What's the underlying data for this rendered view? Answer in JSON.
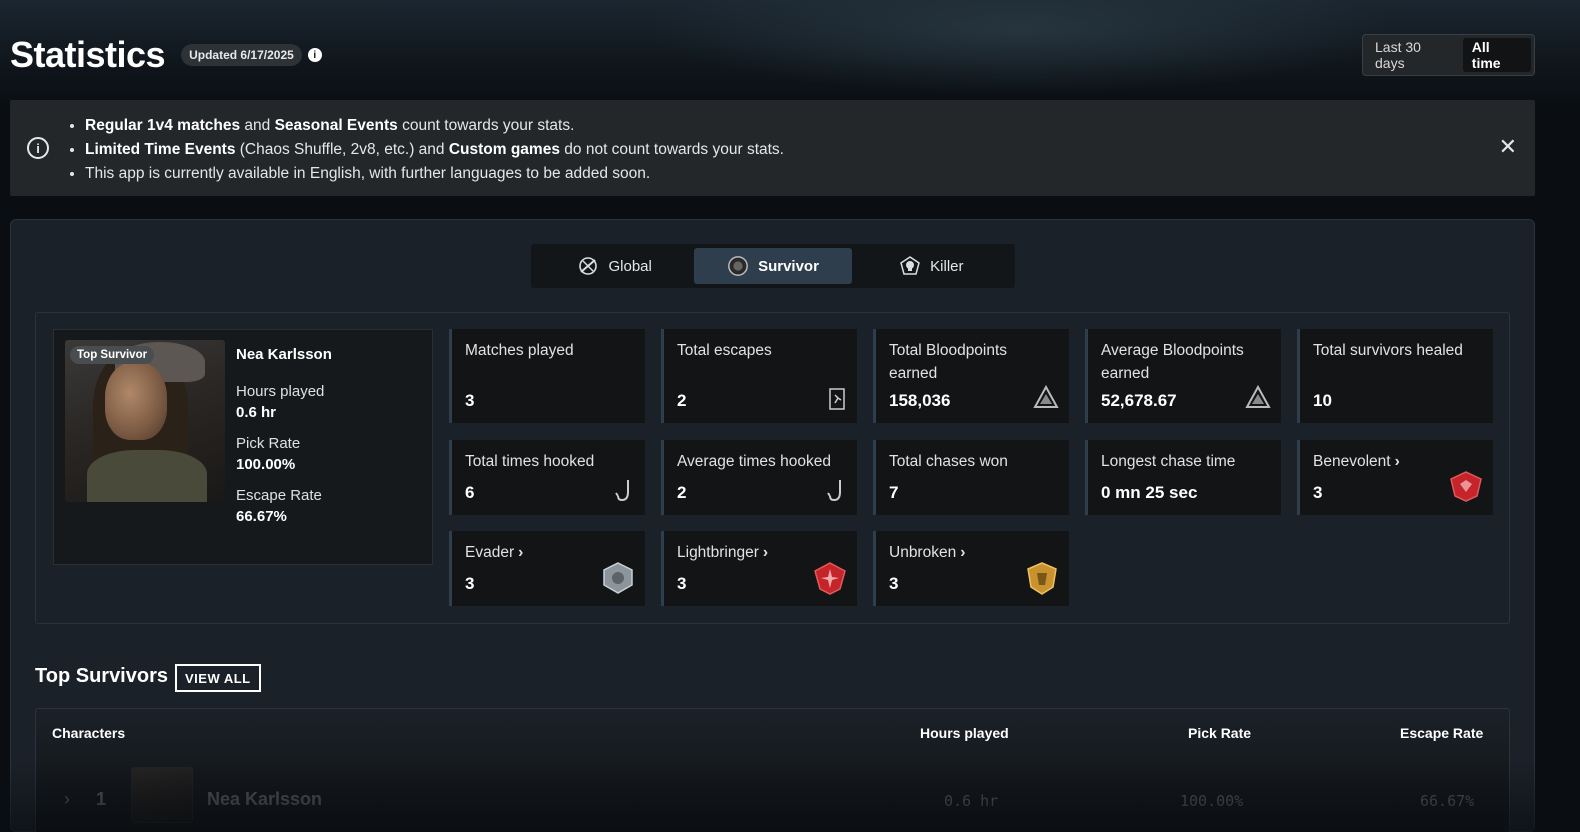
{
  "header": {
    "title": "Statistics",
    "updated": "Updated 6/17/2025",
    "info_glyph": "i"
  },
  "range_toggle": {
    "options": [
      "Last 30 days",
      "All time"
    ],
    "selected": "All time"
  },
  "notice": {
    "icon": "info-circle-icon",
    "line1": {
      "b1": "Regular 1v4 matches",
      "t1": " and ",
      "b2": "Seasonal Events",
      "t2": " count towards your stats."
    },
    "line2": {
      "b1": "Limited Time Events",
      "t1": " (Chaos Shuffle, 2v8, etc.) and ",
      "b2": "Custom games",
      "t2": " do not count towards your stats."
    },
    "line3": "This app is currently available in English, with further languages to be added soon.",
    "close": "✕"
  },
  "tabs": [
    {
      "label": "Global",
      "icon": "global-icon"
    },
    {
      "label": "Survivor",
      "icon": "survivor-icon"
    },
    {
      "label": "Killer",
      "icon": "killer-skull-icon"
    }
  ],
  "tabs_active": "Survivor",
  "character": {
    "badge": "Top Survivor",
    "name": "Nea Karlsson",
    "hours_label": "Hours played",
    "hours_value": "0.6 hr",
    "pick_label": "Pick Rate",
    "pick_value": "100.00%",
    "escape_label": "Escape Rate",
    "escape_value": "66.67%"
  },
  "stats": [
    {
      "label": "Matches played",
      "value": "3",
      "icon": ""
    },
    {
      "label": "Total escapes",
      "value": "2",
      "icon": "exit-door-icon"
    },
    {
      "label": "Total Bloodpoints earned",
      "value": "158,036",
      "icon": "bloodpoints-icon"
    },
    {
      "label": "Average Bloodpoints earned",
      "value": "52,678.67",
      "icon": "bloodpoints-icon"
    },
    {
      "label": "Total survivors healed",
      "value": "10",
      "icon": ""
    },
    {
      "label": "Total times hooked",
      "value": "6",
      "icon": "hook-icon"
    },
    {
      "label": "Average times hooked",
      "value": "2",
      "icon": "hook-icon"
    },
    {
      "label": "Total chases won",
      "value": "7",
      "icon": ""
    },
    {
      "label": "Longest chase time",
      "value": "0 mn 25 sec",
      "icon": ""
    },
    {
      "label": "Benevolent",
      "value": "3",
      "icon": "benevolent-emblem-icon",
      "chevron": "›"
    },
    {
      "label": "Evader",
      "value": "3",
      "icon": "evader-emblem-icon",
      "chevron": "›"
    },
    {
      "label": "Lightbringer",
      "value": "3",
      "icon": "lightbringer-emblem-icon",
      "chevron": "›"
    },
    {
      "label": "Unbroken",
      "value": "3",
      "icon": "unbroken-emblem-icon",
      "chevron": "›"
    }
  ],
  "colors": {
    "emblem_red": "#c4242a",
    "emblem_silver": "#9aa3aa",
    "emblem_gold": "#c8922e",
    "tab_active_bg": "#2e3e4c"
  },
  "top_survivors": {
    "title": "Top Survivors",
    "view_all": "VIEW ALL",
    "columns": [
      "Characters",
      "Hours played",
      "Pick Rate",
      "Escape Rate"
    ],
    "rows": [
      {
        "expand": "›",
        "rank": "1",
        "name": "Nea Karlsson",
        "hours": "0.6 hr",
        "pick": "100.00%",
        "escape": "66.67%"
      }
    ]
  }
}
